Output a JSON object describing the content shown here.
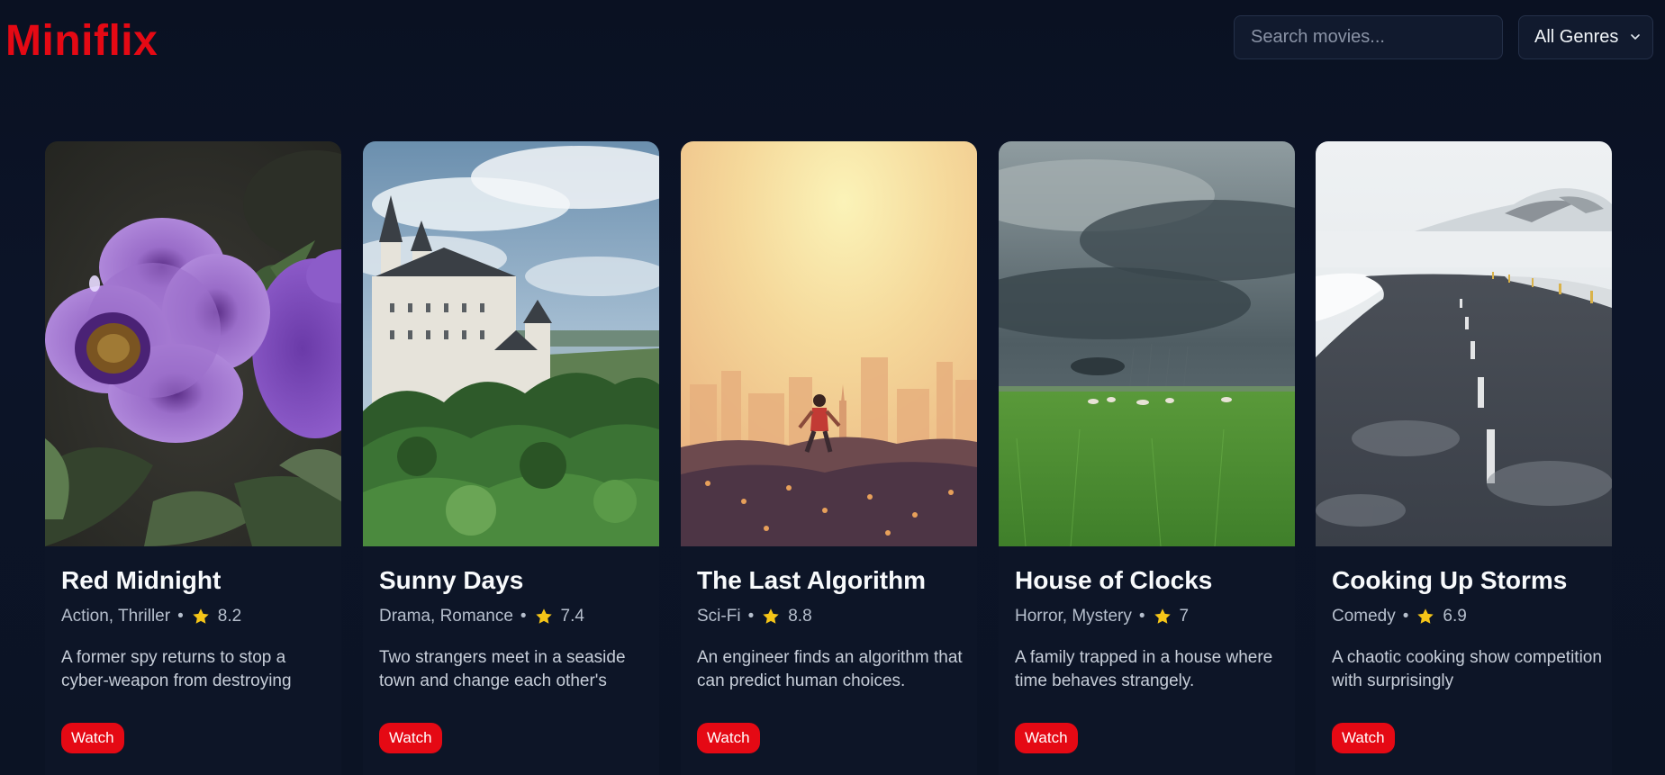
{
  "header": {
    "logo": "Miniflix",
    "search_placeholder": "Search movies...",
    "genre_selected": "All Genres"
  },
  "colors": {
    "brand": "#e50914",
    "background": "#0b1223",
    "card": "#0d1527",
    "star": "#f5c518"
  },
  "movies": [
    {
      "title": "Red Midnight",
      "genres": "Action, Thriller",
      "rating": "8.2",
      "description": "A former spy returns to stop a cyber-weapon from destroying",
      "button": "Watch",
      "poster": "purple-flower-poster"
    },
    {
      "title": "Sunny Days",
      "genres": "Drama, Romance",
      "rating": "7.4",
      "description": "Two strangers meet in a seaside town and change each other's",
      "button": "Watch",
      "poster": "castle-forest-poster"
    },
    {
      "title": "The Last Algorithm",
      "genres": "Sci-Fi",
      "rating": "8.8",
      "description": "An engineer finds an algorithm that can predict human choices.",
      "button": "Watch",
      "poster": "runner-city-sunset-poster"
    },
    {
      "title": "House of Clocks",
      "genres": "Horror, Mystery",
      "rating": "7",
      "description": "A family trapped in a house where time behaves strangely.",
      "button": "Watch",
      "poster": "storm-field-poster"
    },
    {
      "title": "Cooking Up Storms",
      "genres": "Comedy",
      "rating": "6.9",
      "description": "A chaotic cooking show competition with surprisingly",
      "button": "Watch",
      "poster": "snow-road-poster"
    }
  ]
}
